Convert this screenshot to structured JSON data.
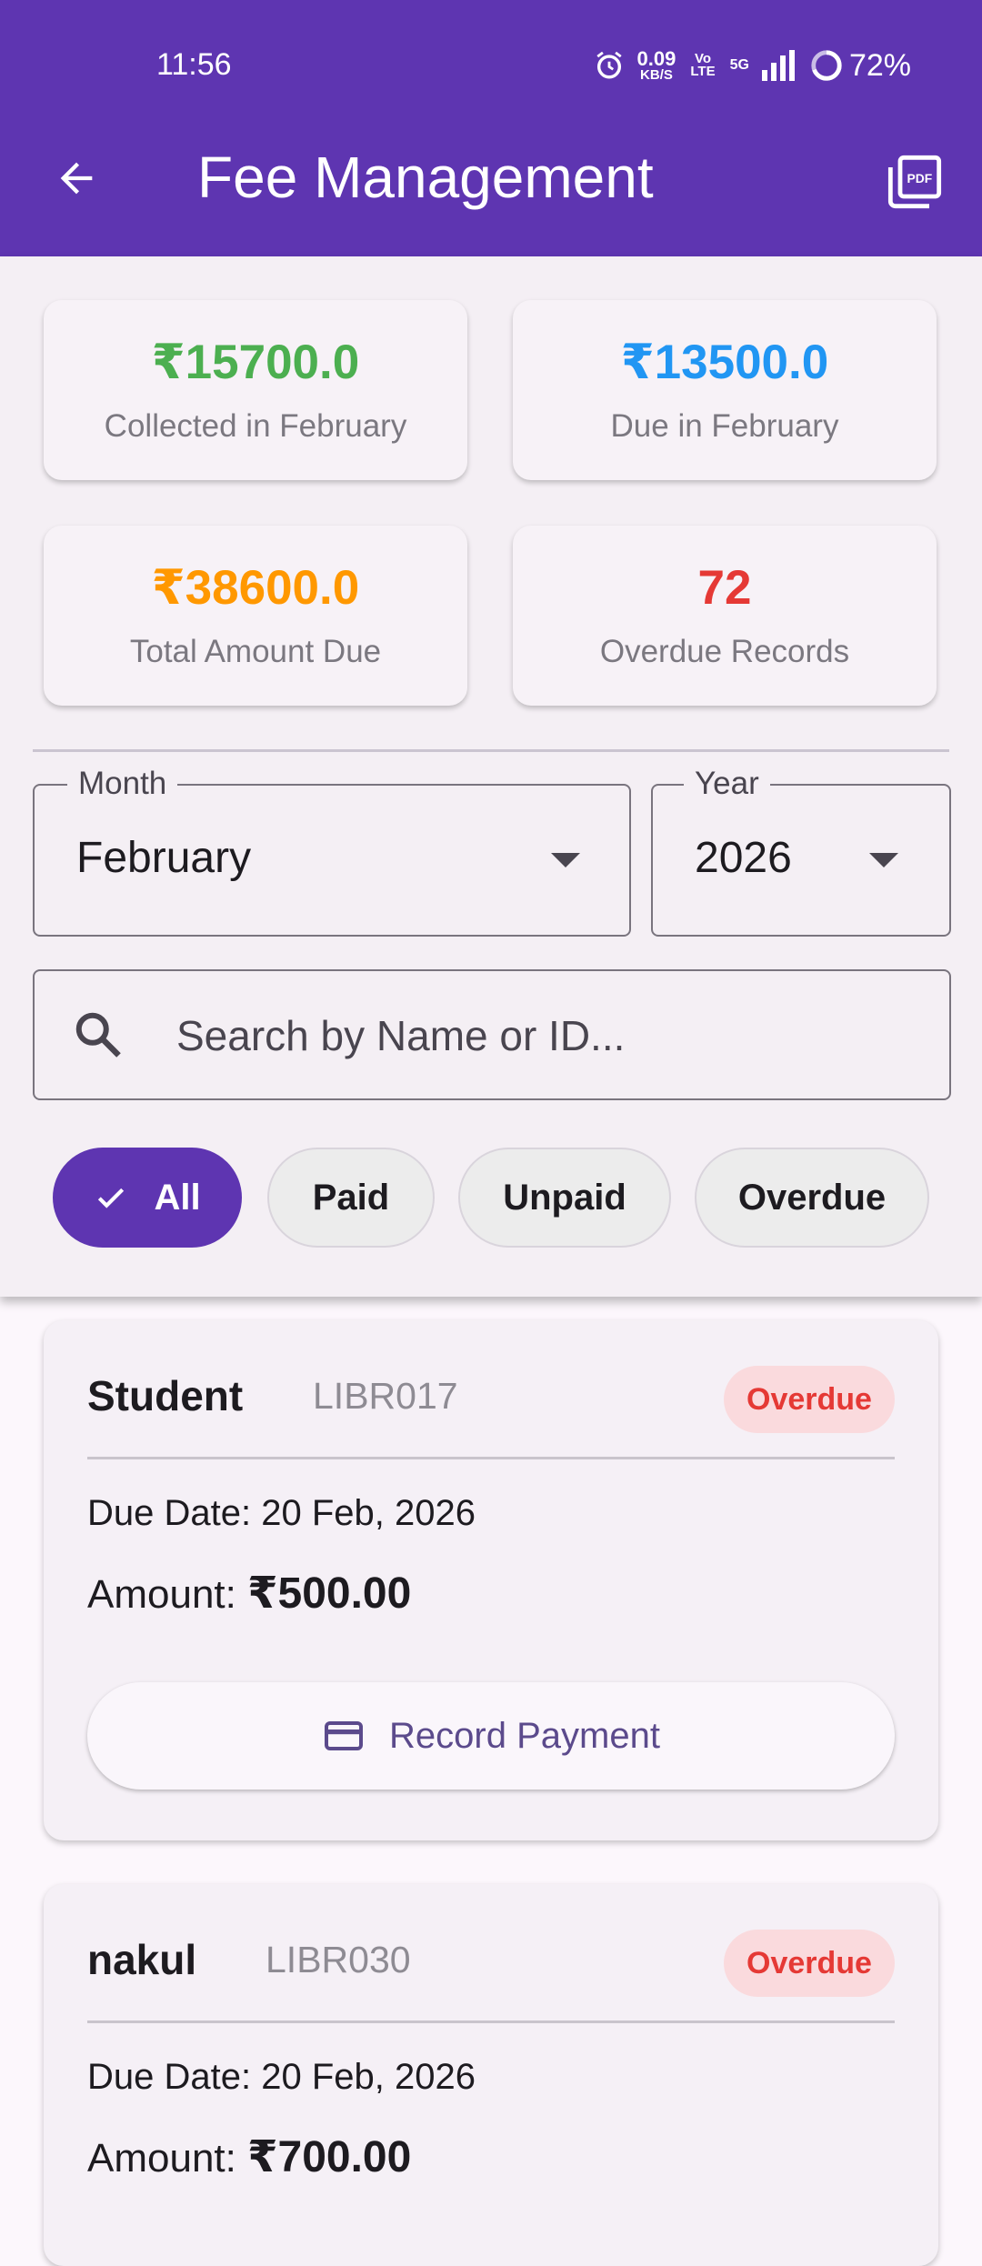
{
  "status_bar": {
    "time": "11:56",
    "net_speed_value": "0.09",
    "net_speed_unit": "KB/S",
    "volte_top": "Vo",
    "volte_bottom": "LTE",
    "network": "5G",
    "battery": "72%"
  },
  "app_bar": {
    "title": "Fee Management",
    "back_icon": "arrow-back-icon",
    "pdf_icon": "pdf-export-icon",
    "color": "#5e35b1"
  },
  "summary": [
    {
      "value": "₹15700.0",
      "label": "Collected in February",
      "color": "#4caf50"
    },
    {
      "value": "₹13500.0",
      "label": "Due in February",
      "color": "#2196f3"
    },
    {
      "value": "₹38600.0",
      "label": "Total Amount Due",
      "color": "#ff9800"
    },
    {
      "value": "72",
      "label": "Overdue Records",
      "color": "#e53935"
    }
  ],
  "filters": {
    "month_label": "Month",
    "month_value": "February",
    "year_label": "Year",
    "year_value": "2026",
    "search_placeholder": "Search by Name or ID..."
  },
  "chips": [
    {
      "label": "All",
      "selected": true
    },
    {
      "label": "Paid",
      "selected": false
    },
    {
      "label": "Unpaid",
      "selected": false
    },
    {
      "label": "Overdue",
      "selected": false
    }
  ],
  "records": [
    {
      "name": "Student",
      "id": "LIBR017",
      "status": "Overdue",
      "due_date_label": "Due Date: 20 Feb, 2026",
      "amount_label": "Amount: ",
      "amount_value": "₹500.00",
      "action_label": "Record Payment"
    },
    {
      "name": "nakul",
      "id": "LIBR030",
      "status": "Overdue",
      "due_date_label": "Due Date: 20 Feb, 2026",
      "amount_label": "Amount: ",
      "amount_value": "₹700.00"
    }
  ]
}
